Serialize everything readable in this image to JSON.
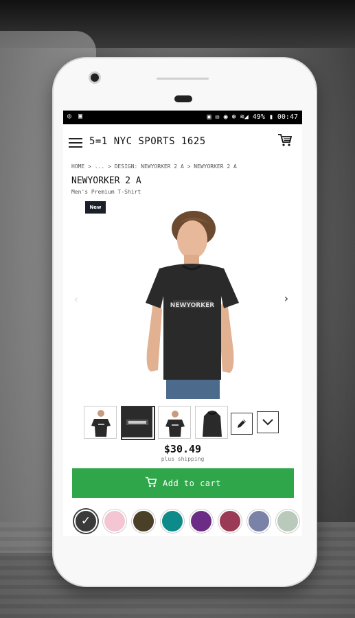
{
  "statusbar": {
    "left_icons": "◎ ▣",
    "right_text": "▣ ✉ ◉ ⊛ ≋◢ 49% ▮ 00:47"
  },
  "appbar": {
    "menu_icon": "hamburger-icon",
    "title": "5=1 NYC SPORTS 1625",
    "cart_icon": "shopping-cart-icon"
  },
  "breadcrumb": {
    "text": "HOME > ... > DESIGN: NEWYORKER 2 A > NEWYORKER 2 A"
  },
  "product": {
    "title": "NEWYORKER 2 A",
    "subtitle": "Men's Premium T-Shirt",
    "badge": "New",
    "shirt_print": "NEWYORKER",
    "price": "$30.49",
    "shipping": "plus shipping"
  },
  "actions": {
    "add_to_cart": "Add to cart"
  },
  "colors": {
    "accent_green": "#2fa64a",
    "swatches": [
      "#3a3a3a",
      "#f4c6d3",
      "#4a4028",
      "#0d8a8a",
      "#6b2c86",
      "#9b3a55",
      "#7a82a8",
      "#b9c9bb"
    ]
  }
}
